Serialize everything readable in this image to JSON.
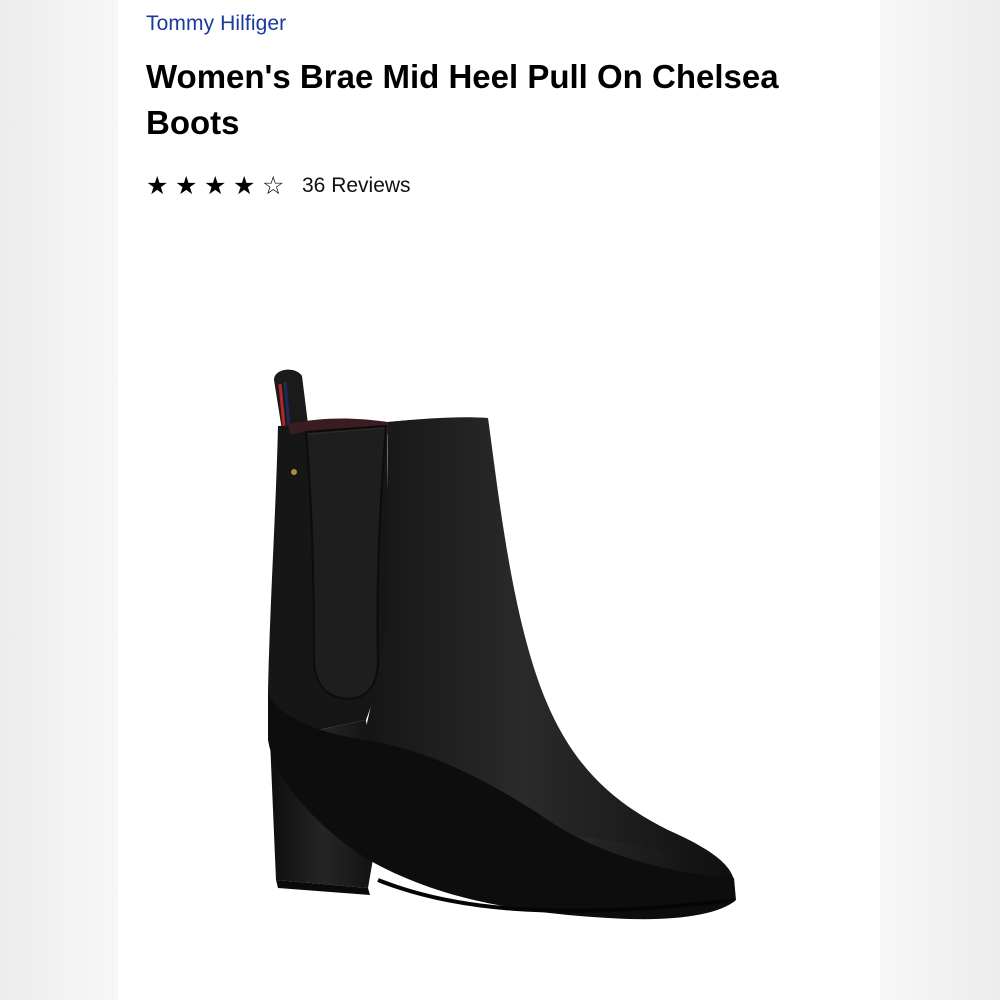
{
  "product": {
    "brand": "Tommy Hilfiger",
    "title": "Women's Brae Mid Heel Pull On Chelsea Boots",
    "rating": {
      "value": 4,
      "max": 5,
      "filled_star": "★",
      "empty_star": "☆",
      "reviews_label": "36 Reviews"
    },
    "image": {
      "icon": "black-chelsea-boot-image",
      "colors": {
        "leather": "#1c1c1c",
        "sole": "#111111",
        "pull_tab_stripe_red": "#b3262b",
        "pull_tab_stripe_navy": "#1d2a55"
      }
    }
  },
  "colors": {
    "brand_link": "#1a3a9c",
    "text": "#000000",
    "page_bg": "#ffffff",
    "backdrop": "#f0f0f0"
  }
}
